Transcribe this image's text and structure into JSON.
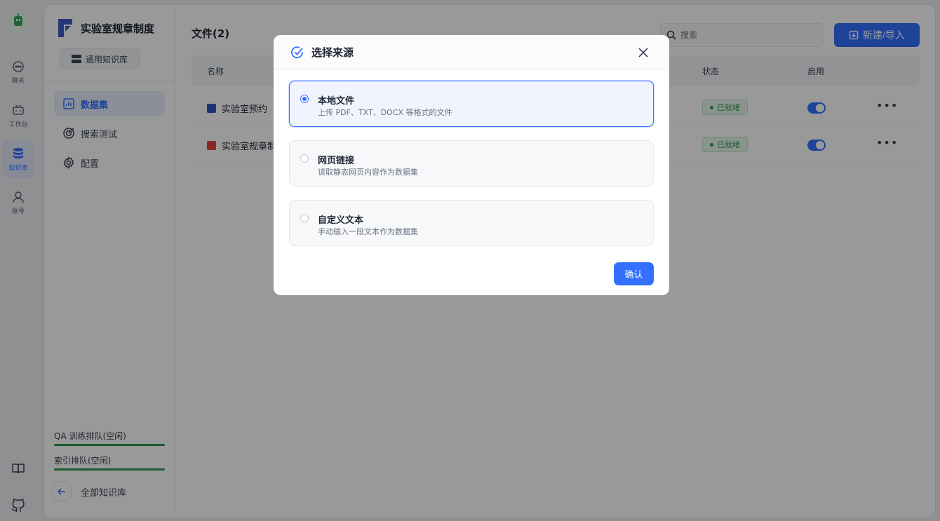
{
  "nav": {
    "items": [
      {
        "label": "聊天",
        "icon": "chat-icon"
      },
      {
        "label": "工作台",
        "icon": "robot-icon"
      },
      {
        "label": "知识库",
        "icon": "database-icon"
      },
      {
        "label": "账号",
        "icon": "user-icon"
      }
    ]
  },
  "sidebar": {
    "kb_name": "实验室规章制度",
    "kb_type": "通用知识库",
    "menu": [
      {
        "label": "数据集"
      },
      {
        "label": "搜索测试"
      },
      {
        "label": "配置"
      }
    ],
    "queue_qa": "QA 训练排队(空闲)",
    "queue_index": "索引排队(空闲)",
    "back_label": "全部知识库"
  },
  "main": {
    "files_title": "文件(2)",
    "search_placeholder": "搜索",
    "new_button": "新建/导入",
    "columns": {
      "name": "名称",
      "status": "状态",
      "enabled": "启用"
    },
    "rows": [
      {
        "name": "实验室预约",
        "status": "已就绪"
      },
      {
        "name": "实验室规章制",
        "status": "已就绪"
      }
    ]
  },
  "modal": {
    "title": "选择来源",
    "options": [
      {
        "title": "本地文件",
        "desc": "上传 PDF、TXT、DOCX 等格式的文件",
        "selected": true
      },
      {
        "title": "网页链接",
        "desc": "读取静态网页内容作为数据集",
        "selected": false
      },
      {
        "title": "自定义文本",
        "desc": "手动输入一段文本作为数据集",
        "selected": false
      }
    ],
    "confirm": "确认"
  },
  "colors": {
    "accent": "#3370ff",
    "success": "#2a9c4d"
  }
}
